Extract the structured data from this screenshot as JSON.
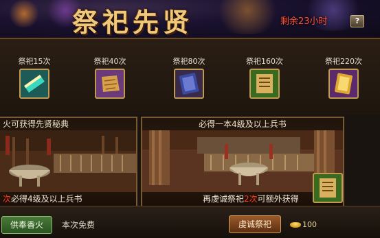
{
  "header": {
    "title": "祭祀先贤",
    "remaining": "剩余23小时",
    "help": "?"
  },
  "rewards": [
    {
      "label": "祭祀15次",
      "icon": "scroll-icon",
      "color": "#30c8b0"
    },
    {
      "label": "祭祀40次",
      "icon": "map-icon",
      "color": "#c89040"
    },
    {
      "label": "祭祀80次",
      "icon": "book-icon",
      "color": "#5060c0"
    },
    {
      "label": "祭祀160次",
      "icon": "manual-icon",
      "color": "#a0c040"
    },
    {
      "label": "祭祀220次",
      "icon": "golden-book-icon",
      "color": "#d0a030"
    }
  ],
  "panel_left": {
    "head": "火可获得先贤秘典",
    "foot_red": "次",
    "foot": "必得4级及以上兵书"
  },
  "panel_right": {
    "head": "必得一本4级及以上兵书",
    "foot_a": "再虔诚祭祀",
    "foot_red": "2次",
    "foot_b": "可额外获得"
  },
  "actions": {
    "offer_incense": "供奉香火",
    "free_note": "本次免费",
    "devout_sacrifice": "虔诚祭祀",
    "cost": "100"
  }
}
